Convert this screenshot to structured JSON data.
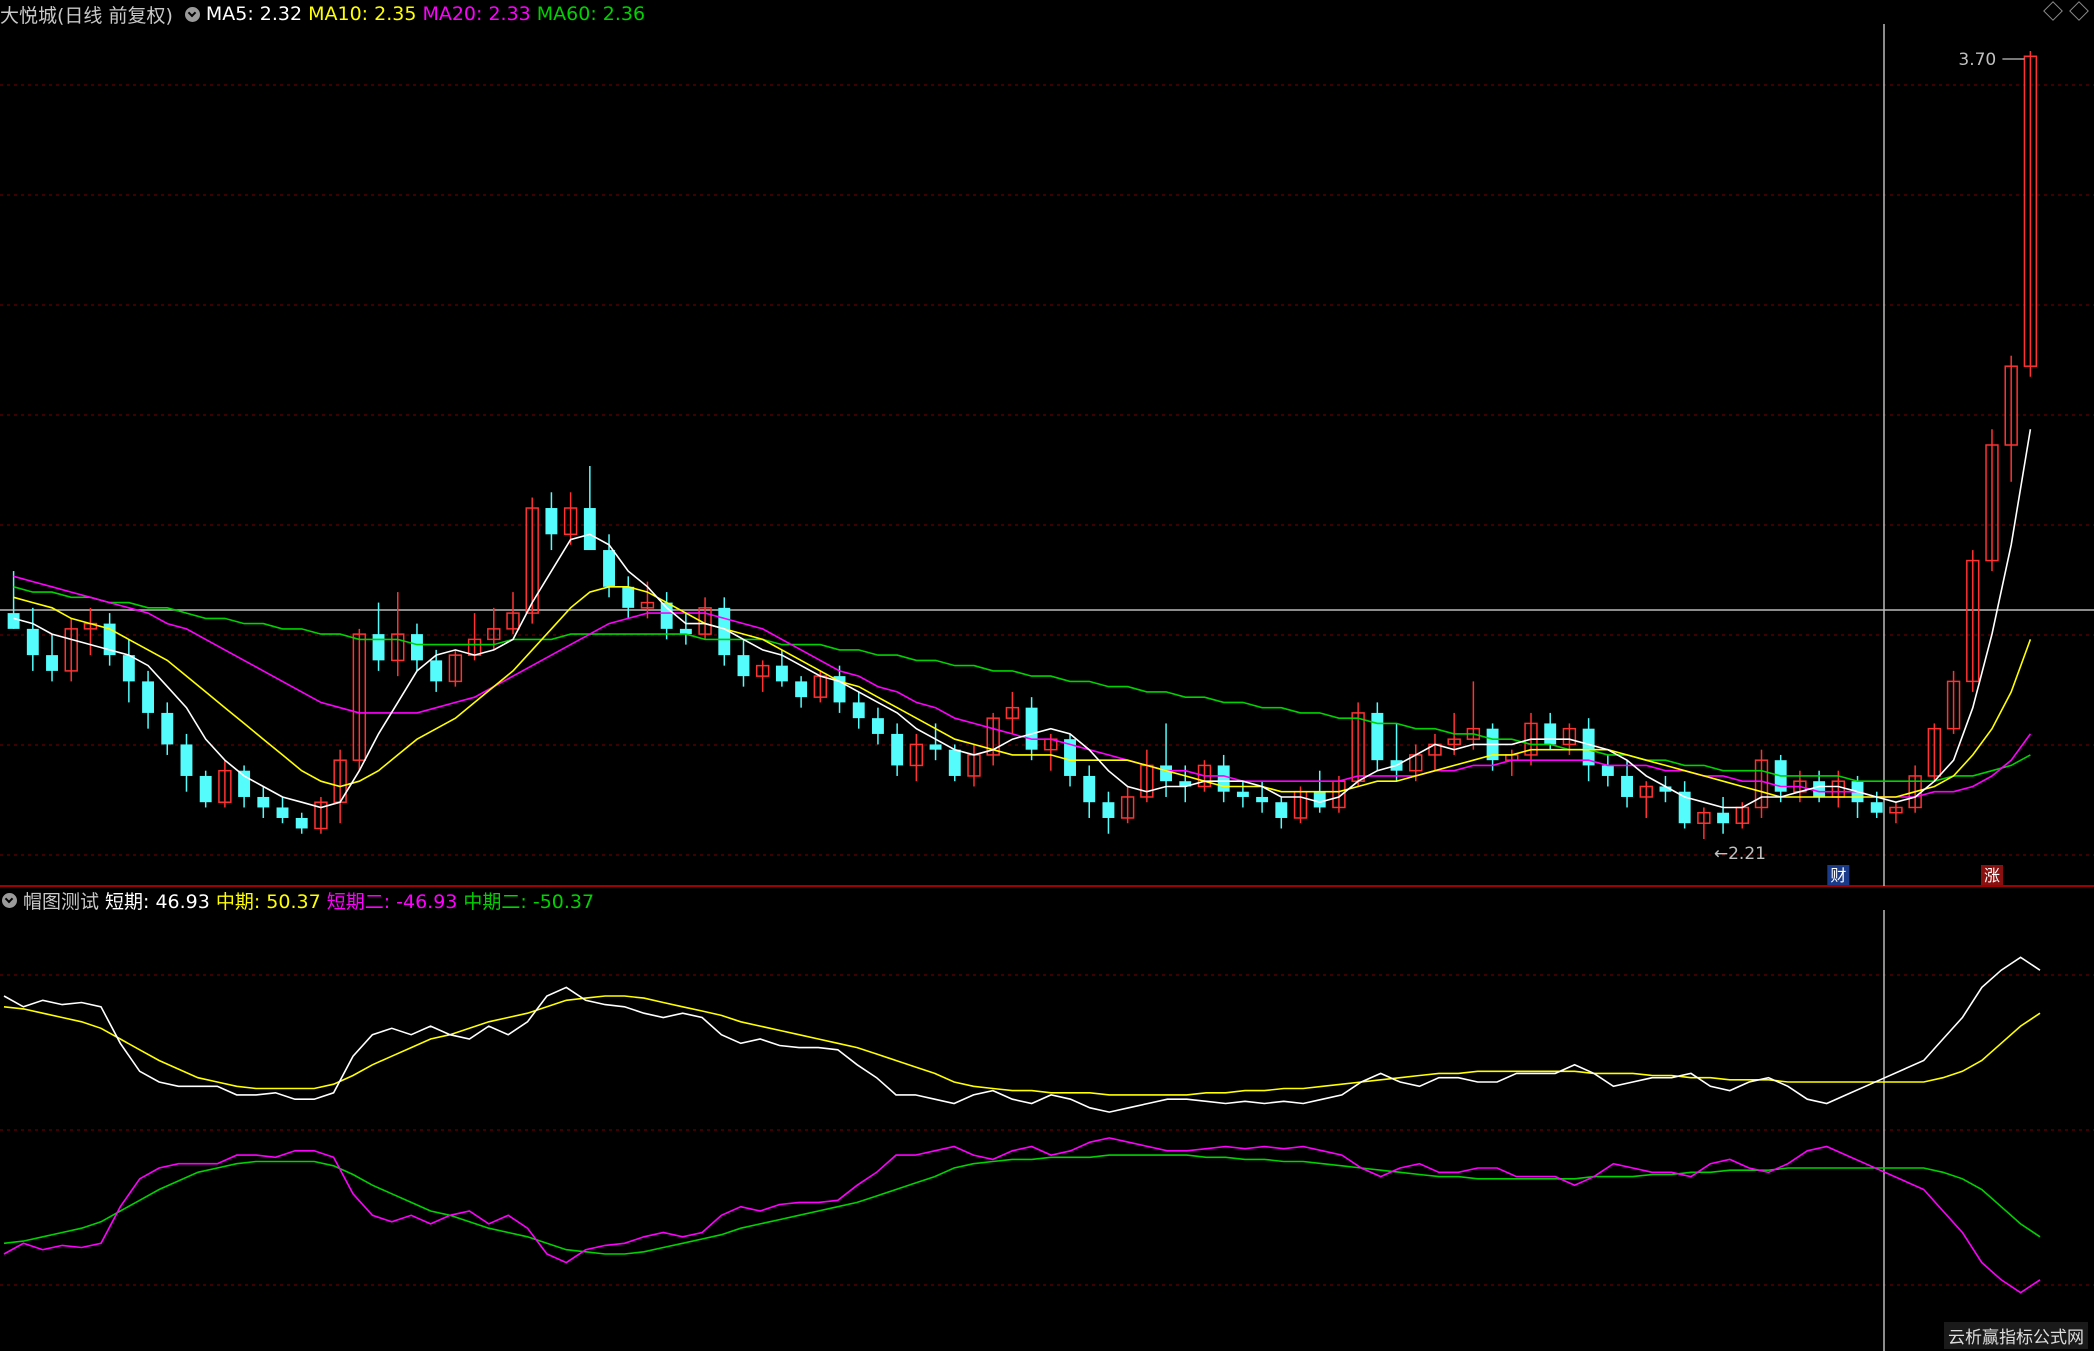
{
  "header_top": {
    "stock": "大悦城(日线 前复权)",
    "ma5": "MA5: 2.32",
    "ma10": "MA10: 2.35",
    "ma20": "MA20: 2.33",
    "ma60": "MA60: 2.36"
  },
  "header_bottom": {
    "name": "帽图测试",
    "s1": "短期: 46.93",
    "s2": "中期: 50.37",
    "s3": "短期二: -46.93",
    "s4": "中期二: -50.37"
  },
  "watermark": "云析赢指标公式网",
  "colors": {
    "up": "#ff3232",
    "down": "#54fcfc",
    "ma5": "#ffffff",
    "ma10": "#ffff00",
    "ma20": "#ff00ff",
    "ma60": "#00d200",
    "grid": "#7a0000",
    "separator": "#a00000"
  },
  "chart_data": [
    {
      "type": "candlestick",
      "ylim": [
        2.16,
        3.74
      ],
      "price_labels": [
        "3.70",
        "2.21"
      ],
      "markers": [
        {
          "label": "财",
          "index": 95
        },
        {
          "label": "涨",
          "index": 103
        }
      ],
      "ohlc": [
        [
          2.63,
          2.71,
          2.6,
          2.6
        ],
        [
          2.6,
          2.64,
          2.52,
          2.55
        ],
        [
          2.55,
          2.59,
          2.5,
          2.52
        ],
        [
          2.52,
          2.62,
          2.5,
          2.6
        ],
        [
          2.6,
          2.64,
          2.55,
          2.61
        ],
        [
          2.61,
          2.63,
          2.53,
          2.55
        ],
        [
          2.55,
          2.58,
          2.46,
          2.5
        ],
        [
          2.5,
          2.52,
          2.41,
          2.44
        ],
        [
          2.44,
          2.46,
          2.36,
          2.38
        ],
        [
          2.38,
          2.4,
          2.29,
          2.32
        ],
        [
          2.32,
          2.33,
          2.26,
          2.27
        ],
        [
          2.27,
          2.35,
          2.26,
          2.33
        ],
        [
          2.33,
          2.34,
          2.26,
          2.28
        ],
        [
          2.28,
          2.3,
          2.24,
          2.26
        ],
        [
          2.26,
          2.28,
          2.23,
          2.24
        ],
        [
          2.24,
          2.25,
          2.21,
          2.22
        ],
        [
          2.22,
          2.28,
          2.21,
          2.27
        ],
        [
          2.27,
          2.37,
          2.23,
          2.35
        ],
        [
          2.35,
          2.6,
          2.33,
          2.59
        ],
        [
          2.59,
          2.65,
          2.52,
          2.54
        ],
        [
          2.54,
          2.67,
          2.51,
          2.59
        ],
        [
          2.59,
          2.61,
          2.52,
          2.54
        ],
        [
          2.54,
          2.56,
          2.48,
          2.5
        ],
        [
          2.5,
          2.56,
          2.49,
          2.55
        ],
        [
          2.55,
          2.63,
          2.54,
          2.58
        ],
        [
          2.58,
          2.64,
          2.56,
          2.6
        ],
        [
          2.6,
          2.67,
          2.59,
          2.63
        ],
        [
          2.63,
          2.85,
          2.61,
          2.83
        ],
        [
          2.83,
          2.86,
          2.75,
          2.78
        ],
        [
          2.78,
          2.86,
          2.76,
          2.83
        ],
        [
          2.83,
          2.91,
          2.81,
          2.75
        ],
        [
          2.75,
          2.78,
          2.66,
          2.68
        ],
        [
          2.68,
          2.7,
          2.62,
          2.64
        ],
        [
          2.64,
          2.69,
          2.62,
          2.65
        ],
        [
          2.65,
          2.67,
          2.58,
          2.6
        ],
        [
          2.6,
          2.63,
          2.57,
          2.59
        ],
        [
          2.59,
          2.66,
          2.58,
          2.64
        ],
        [
          2.64,
          2.66,
          2.53,
          2.55
        ],
        [
          2.55,
          2.58,
          2.49,
          2.51
        ],
        [
          2.51,
          2.54,
          2.48,
          2.53
        ],
        [
          2.53,
          2.56,
          2.49,
          2.5
        ],
        [
          2.5,
          2.51,
          2.45,
          2.47
        ],
        [
          2.47,
          2.52,
          2.46,
          2.51
        ],
        [
          2.51,
          2.53,
          2.44,
          2.46
        ],
        [
          2.46,
          2.48,
          2.41,
          2.43
        ],
        [
          2.43,
          2.45,
          2.38,
          2.4
        ],
        [
          2.4,
          2.42,
          2.32,
          2.34
        ],
        [
          2.34,
          2.4,
          2.31,
          2.38
        ],
        [
          2.38,
          2.42,
          2.35,
          2.37
        ],
        [
          2.37,
          2.38,
          2.31,
          2.32
        ],
        [
          2.32,
          2.38,
          2.3,
          2.36
        ],
        [
          2.36,
          2.44,
          2.34,
          2.43
        ],
        [
          2.43,
          2.48,
          2.4,
          2.45
        ],
        [
          2.45,
          2.47,
          2.35,
          2.37
        ],
        [
          2.37,
          2.4,
          2.33,
          2.39
        ],
        [
          2.39,
          2.4,
          2.3,
          2.32
        ],
        [
          2.32,
          2.34,
          2.24,
          2.27
        ],
        [
          2.27,
          2.29,
          2.21,
          2.24
        ],
        [
          2.24,
          2.3,
          2.23,
          2.28
        ],
        [
          2.28,
          2.37,
          2.27,
          2.34
        ],
        [
          2.34,
          2.42,
          2.28,
          2.31
        ],
        [
          2.31,
          2.34,
          2.27,
          2.3
        ],
        [
          2.3,
          2.35,
          2.29,
          2.34
        ],
        [
          2.34,
          2.36,
          2.27,
          2.29
        ],
        [
          2.29,
          2.31,
          2.26,
          2.28
        ],
        [
          2.28,
          2.31,
          2.25,
          2.27
        ],
        [
          2.27,
          2.28,
          2.22,
          2.24
        ],
        [
          2.24,
          2.3,
          2.23,
          2.29
        ],
        [
          2.29,
          2.33,
          2.25,
          2.26
        ],
        [
          2.26,
          2.32,
          2.25,
          2.31
        ],
        [
          2.31,
          2.46,
          2.3,
          2.44
        ],
        [
          2.44,
          2.46,
          2.33,
          2.35
        ],
        [
          2.35,
          2.42,
          2.31,
          2.33
        ],
        [
          2.33,
          2.38,
          2.31,
          2.36
        ],
        [
          2.36,
          2.4,
          2.33,
          2.38
        ],
        [
          2.38,
          2.44,
          2.36,
          2.39
        ],
        [
          2.39,
          2.5,
          2.37,
          2.41
        ],
        [
          2.41,
          2.42,
          2.33,
          2.35
        ],
        [
          2.35,
          2.37,
          2.32,
          2.36
        ],
        [
          2.36,
          2.44,
          2.34,
          2.42
        ],
        [
          2.42,
          2.44,
          2.37,
          2.38
        ],
        [
          2.38,
          2.42,
          2.36,
          2.41
        ],
        [
          2.41,
          2.43,
          2.31,
          2.34
        ],
        [
          2.34,
          2.36,
          2.3,
          2.32
        ],
        [
          2.32,
          2.35,
          2.26,
          2.28
        ],
        [
          2.28,
          2.31,
          2.24,
          2.3
        ],
        [
          2.3,
          2.32,
          2.27,
          2.29
        ],
        [
          2.29,
          2.31,
          2.22,
          2.23
        ],
        [
          2.23,
          2.26,
          2.2,
          2.25
        ],
        [
          2.25,
          2.28,
          2.21,
          2.23
        ],
        [
          2.23,
          2.27,
          2.22,
          2.26
        ],
        [
          2.26,
          2.37,
          2.24,
          2.35
        ],
        [
          2.35,
          2.36,
          2.27,
          2.29
        ],
        [
          2.29,
          2.33,
          2.27,
          2.31
        ],
        [
          2.31,
          2.33,
          2.27,
          2.28
        ],
        [
          2.28,
          2.33,
          2.26,
          2.31
        ],
        [
          2.31,
          2.32,
          2.24,
          2.27
        ],
        [
          2.27,
          2.29,
          2.24,
          2.25
        ],
        [
          2.25,
          2.27,
          2.23,
          2.26
        ],
        [
          2.26,
          2.34,
          2.25,
          2.32
        ],
        [
          2.32,
          2.42,
          2.31,
          2.41
        ],
        [
          2.41,
          2.52,
          2.4,
          2.5
        ],
        [
          2.5,
          2.75,
          2.48,
          2.73
        ],
        [
          2.73,
          2.98,
          2.71,
          2.95
        ],
        [
          2.95,
          3.12,
          2.88,
          3.1
        ],
        [
          3.1,
          3.7,
          3.08,
          3.69
        ]
      ],
      "ma5": [
        2.62,
        2.61,
        2.59,
        2.58,
        2.57,
        2.56,
        2.55,
        2.53,
        2.49,
        2.45,
        2.39,
        2.35,
        2.32,
        2.3,
        2.28,
        2.27,
        2.26,
        2.27,
        2.33,
        2.4,
        2.46,
        2.52,
        2.55,
        2.56,
        2.55,
        2.56,
        2.58,
        2.65,
        2.71,
        2.77,
        2.78,
        2.76,
        2.71,
        2.68,
        2.64,
        2.61,
        2.61,
        2.6,
        2.58,
        2.56,
        2.55,
        2.53,
        2.51,
        2.5,
        2.48,
        2.46,
        2.44,
        2.41,
        2.39,
        2.37,
        2.36,
        2.37,
        2.39,
        2.4,
        2.41,
        2.4,
        2.37,
        2.33,
        2.3,
        2.29,
        2.3,
        2.3,
        2.31,
        2.31,
        2.31,
        2.3,
        2.28,
        2.28,
        2.27,
        2.28,
        2.31,
        2.33,
        2.34,
        2.36,
        2.38,
        2.37,
        2.38,
        2.38,
        2.38,
        2.39,
        2.39,
        2.39,
        2.38,
        2.37,
        2.35,
        2.32,
        2.3,
        2.28,
        2.27,
        2.26,
        2.26,
        2.28,
        2.28,
        2.29,
        2.3,
        2.3,
        2.29,
        2.28,
        2.27,
        2.28,
        2.31,
        2.35,
        2.45,
        2.59,
        2.76,
        2.98
      ],
      "ma10": [
        2.66,
        2.65,
        2.64,
        2.62,
        2.61,
        2.6,
        2.58,
        2.56,
        2.54,
        2.51,
        2.48,
        2.45,
        2.42,
        2.39,
        2.36,
        2.33,
        2.31,
        2.3,
        2.31,
        2.33,
        2.36,
        2.39,
        2.41,
        2.43,
        2.46,
        2.49,
        2.52,
        2.56,
        2.6,
        2.64,
        2.67,
        2.68,
        2.68,
        2.67,
        2.65,
        2.63,
        2.61,
        2.6,
        2.59,
        2.58,
        2.56,
        2.54,
        2.52,
        2.5,
        2.49,
        2.47,
        2.45,
        2.43,
        2.41,
        2.39,
        2.38,
        2.37,
        2.36,
        2.36,
        2.36,
        2.35,
        2.35,
        2.35,
        2.35,
        2.34,
        2.33,
        2.32,
        2.31,
        2.3,
        2.3,
        2.3,
        2.29,
        2.29,
        2.29,
        2.29,
        2.3,
        2.31,
        2.31,
        2.32,
        2.33,
        2.34,
        2.35,
        2.36,
        2.36,
        2.37,
        2.37,
        2.37,
        2.37,
        2.37,
        2.36,
        2.35,
        2.34,
        2.33,
        2.32,
        2.31,
        2.3,
        2.29,
        2.28,
        2.28,
        2.28,
        2.28,
        2.28,
        2.28,
        2.28,
        2.29,
        2.3,
        2.32,
        2.36,
        2.41,
        2.48,
        2.58
      ],
      "ma20": [
        2.7,
        2.69,
        2.68,
        2.67,
        2.66,
        2.65,
        2.64,
        2.63,
        2.61,
        2.6,
        2.58,
        2.56,
        2.54,
        2.52,
        2.5,
        2.48,
        2.46,
        2.45,
        2.44,
        2.44,
        2.44,
        2.44,
        2.45,
        2.46,
        2.47,
        2.49,
        2.51,
        2.53,
        2.55,
        2.57,
        2.59,
        2.61,
        2.62,
        2.63,
        2.63,
        2.63,
        2.63,
        2.62,
        2.61,
        2.6,
        2.58,
        2.56,
        2.54,
        2.52,
        2.51,
        2.49,
        2.48,
        2.46,
        2.45,
        2.43,
        2.42,
        2.41,
        2.4,
        2.39,
        2.39,
        2.38,
        2.37,
        2.36,
        2.35,
        2.34,
        2.33,
        2.33,
        2.32,
        2.32,
        2.31,
        2.31,
        2.31,
        2.31,
        2.31,
        2.31,
        2.32,
        2.32,
        2.32,
        2.32,
        2.33,
        2.33,
        2.34,
        2.34,
        2.35,
        2.35,
        2.35,
        2.35,
        2.35,
        2.34,
        2.34,
        2.34,
        2.33,
        2.33,
        2.32,
        2.32,
        2.31,
        2.31,
        2.3,
        2.3,
        2.29,
        2.29,
        2.29,
        2.28,
        2.28,
        2.28,
        2.29,
        2.29,
        2.3,
        2.32,
        2.35,
        2.4
      ],
      "ma60": [
        2.68,
        2.67,
        2.67,
        2.66,
        2.66,
        2.65,
        2.65,
        2.64,
        2.64,
        2.63,
        2.62,
        2.62,
        2.61,
        2.61,
        2.6,
        2.6,
        2.59,
        2.59,
        2.58,
        2.58,
        2.58,
        2.57,
        2.57,
        2.57,
        2.57,
        2.57,
        2.58,
        2.58,
        2.58,
        2.59,
        2.59,
        2.59,
        2.59,
        2.59,
        2.59,
        2.59,
        2.58,
        2.58,
        2.58,
        2.58,
        2.57,
        2.57,
        2.57,
        2.56,
        2.56,
        2.55,
        2.55,
        2.54,
        2.54,
        2.53,
        2.53,
        2.52,
        2.52,
        2.51,
        2.51,
        2.5,
        2.5,
        2.49,
        2.49,
        2.48,
        2.48,
        2.47,
        2.47,
        2.46,
        2.46,
        2.45,
        2.45,
        2.44,
        2.44,
        2.43,
        2.43,
        2.42,
        2.42,
        2.41,
        2.41,
        2.4,
        2.4,
        2.39,
        2.39,
        2.38,
        2.38,
        2.37,
        2.37,
        2.36,
        2.36,
        2.35,
        2.35,
        2.34,
        2.34,
        2.33,
        2.33,
        2.33,
        2.32,
        2.32,
        2.32,
        2.32,
        2.31,
        2.31,
        2.31,
        2.31,
        2.31,
        2.32,
        2.32,
        2.33,
        2.34,
        2.36
      ]
    },
    {
      "type": "line",
      "ylim": [
        -100,
        100
      ],
      "series": [
        {
          "name": "短期",
          "color": "#ffffff",
          "values": [
            60,
            55,
            58,
            56,
            57,
            55,
            38,
            25,
            20,
            18,
            18,
            18,
            14,
            14,
            15,
            12,
            12,
            15,
            32,
            42,
            45,
            42,
            46,
            42,
            40,
            46,
            42,
            48,
            60,
            64,
            58,
            56,
            55,
            52,
            50,
            52,
            50,
            42,
            38,
            40,
            37,
            36,
            36,
            35,
            28,
            22,
            14,
            14,
            12,
            10,
            14,
            16,
            12,
            10,
            14,
            12,
            8,
            6,
            8,
            10,
            12,
            12,
            11,
            10,
            11,
            10,
            11,
            10,
            12,
            14,
            20,
            24,
            20,
            18,
            22,
            22,
            20,
            20,
            24,
            24,
            24,
            28,
            24,
            18,
            20,
            22,
            22,
            24,
            18,
            16,
            20,
            22,
            18,
            12,
            10,
            14,
            18,
            22,
            26,
            30,
            40,
            50,
            64,
            72,
            78,
            72
          ]
        },
        {
          "name": "中期",
          "color": "#ffff00",
          "values": [
            55,
            54,
            52,
            50,
            48,
            45,
            40,
            35,
            30,
            26,
            22,
            20,
            18,
            17,
            17,
            17,
            17,
            19,
            23,
            28,
            32,
            36,
            40,
            42,
            45,
            48,
            50,
            52,
            55,
            58,
            59,
            60,
            60,
            59,
            57,
            55,
            53,
            51,
            48,
            46,
            44,
            42,
            40,
            38,
            36,
            33,
            30,
            27,
            24,
            20,
            18,
            17,
            16,
            16,
            15,
            15,
            15,
            14,
            14,
            14,
            14,
            14,
            15,
            15,
            16,
            16,
            17,
            17,
            18,
            19,
            20,
            21,
            22,
            23,
            24,
            24,
            25,
            25,
            25,
            25,
            25,
            25,
            24,
            24,
            24,
            23,
            23,
            22,
            22,
            21,
            21,
            21,
            20,
            20,
            20,
            20,
            20,
            20,
            20,
            20,
            22,
            25,
            30,
            38,
            46,
            52
          ]
        }
      ],
      "mirror_series": [
        {
          "name": "短期二",
          "color": "#ff00ff",
          "note_mirror_of": "短期"
        },
        {
          "name": "中期二",
          "color": "#00d200",
          "note_mirror_of": "中期"
        }
      ]
    }
  ]
}
